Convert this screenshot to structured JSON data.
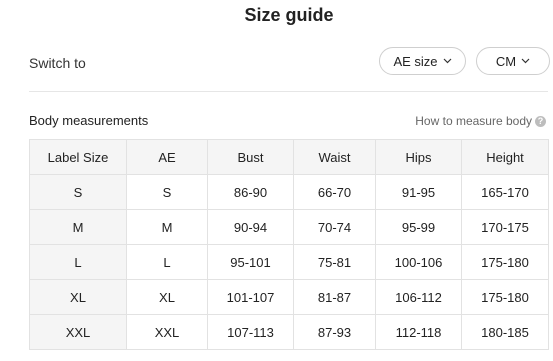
{
  "header": {
    "title": "Size guide"
  },
  "switch": {
    "label": "Switch to",
    "size_system": "AE size",
    "unit": "CM"
  },
  "section": {
    "title": "Body measurements",
    "help_link": "How to measure body"
  },
  "table": {
    "columns": [
      "Label Size",
      "AE",
      "Bust",
      "Waist",
      "Hips",
      "Height"
    ],
    "rows": [
      [
        "S",
        "S",
        "86-90",
        "66-70",
        "91-95",
        "165-170"
      ],
      [
        "M",
        "M",
        "90-94",
        "70-74",
        "95-99",
        "170-175"
      ],
      [
        "L",
        "L",
        "95-101",
        "75-81",
        "100-106",
        "175-180"
      ],
      [
        "XL",
        "XL",
        "101-107",
        "81-87",
        "106-112",
        "175-180"
      ],
      [
        "XXL",
        "XXL",
        "107-113",
        "87-93",
        "112-118",
        "180-185"
      ]
    ]
  }
}
